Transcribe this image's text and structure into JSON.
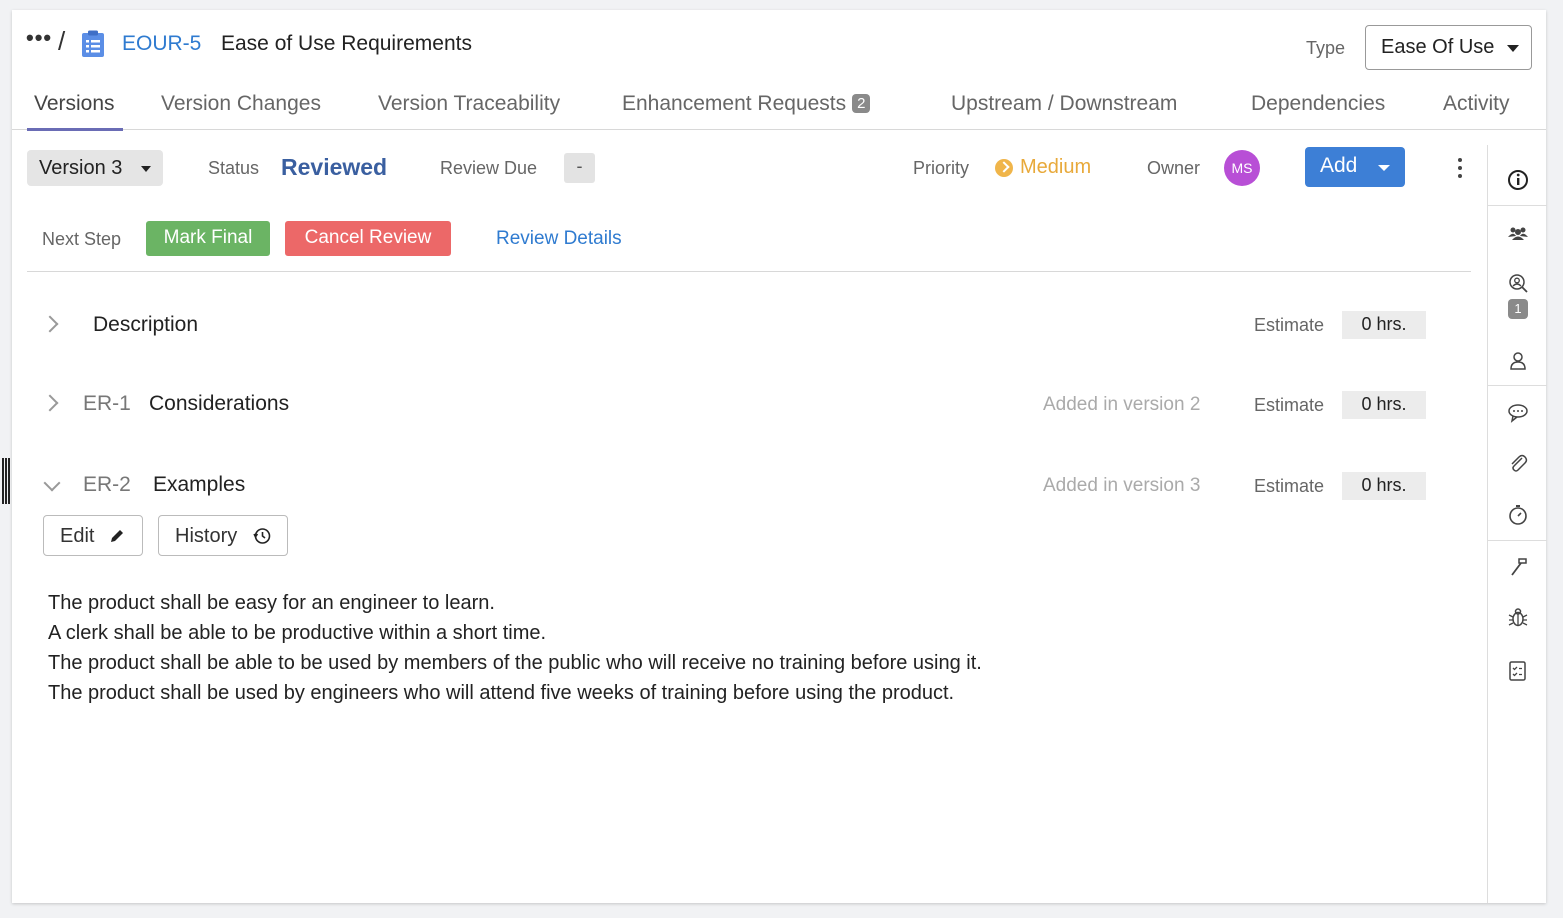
{
  "header": {
    "ellipsis": "•••",
    "separator": "/",
    "req_id": "EOUR-5",
    "title": "Ease of Use Requirements",
    "type_label": "Type",
    "type_value": "Ease Of Use"
  },
  "tabs": [
    {
      "label": "Versions",
      "active": true
    },
    {
      "label": "Version Changes"
    },
    {
      "label": "Version Traceability"
    },
    {
      "label": "Enhancement Requests",
      "badge": "2"
    },
    {
      "label": "Upstream / Downstream"
    },
    {
      "label": "Dependencies"
    },
    {
      "label": "Activity"
    }
  ],
  "status_bar": {
    "version": "Version 3",
    "status_label": "Status",
    "status_value": "Reviewed",
    "review_due_label": "Review Due",
    "review_due_value": "-",
    "priority_label": "Priority",
    "priority_value": "Medium",
    "owner_label": "Owner",
    "owner_initials": "MS",
    "add_label": "Add"
  },
  "next_step": {
    "label": "Next Step",
    "mark_final": "Mark Final",
    "cancel_review": "Cancel Review",
    "review_details": "Review Details"
  },
  "sections": [
    {
      "id": "",
      "title": "Description",
      "added": "",
      "estimate_label": "Estimate",
      "estimate": "0 hrs.",
      "expanded": false
    },
    {
      "id": "ER-1",
      "title": "Considerations",
      "added": "Added in version 2",
      "estimate_label": "Estimate",
      "estimate": "0 hrs.",
      "expanded": false
    },
    {
      "id": "ER-2",
      "title": "Examples",
      "added": "Added in version 3",
      "estimate_label": "Estimate",
      "estimate": "0 hrs.",
      "expanded": true
    }
  ],
  "actions": {
    "edit": "Edit",
    "history": "History"
  },
  "content_lines": [
    "The product shall be easy for an engineer to learn.",
    "A clerk shall be able to be productive within a short time.",
    "The product shall be able to be used by members of the public who will receive no training before using it.",
    "The product shall be used by engineers who will attend five weeks of training before using the product."
  ],
  "sidebar": {
    "icons": [
      "info-icon",
      "team-icon",
      "reviewer-icon",
      "person-icon",
      "comments-icon",
      "attachment-icon",
      "timer-icon",
      "hammer-icon",
      "bug-icon",
      "checklist-icon"
    ],
    "reviewer_badge": "1"
  },
  "colors": {
    "accent": "#2f7bd0",
    "status": "#3a5fa0",
    "priority": "#e8a93a",
    "mark_final": "#6bb464",
    "cancel_review": "#ec6868",
    "add": "#3d7fd6",
    "avatar": "#b84fd6",
    "tab_underline": "#6a6cb5"
  }
}
